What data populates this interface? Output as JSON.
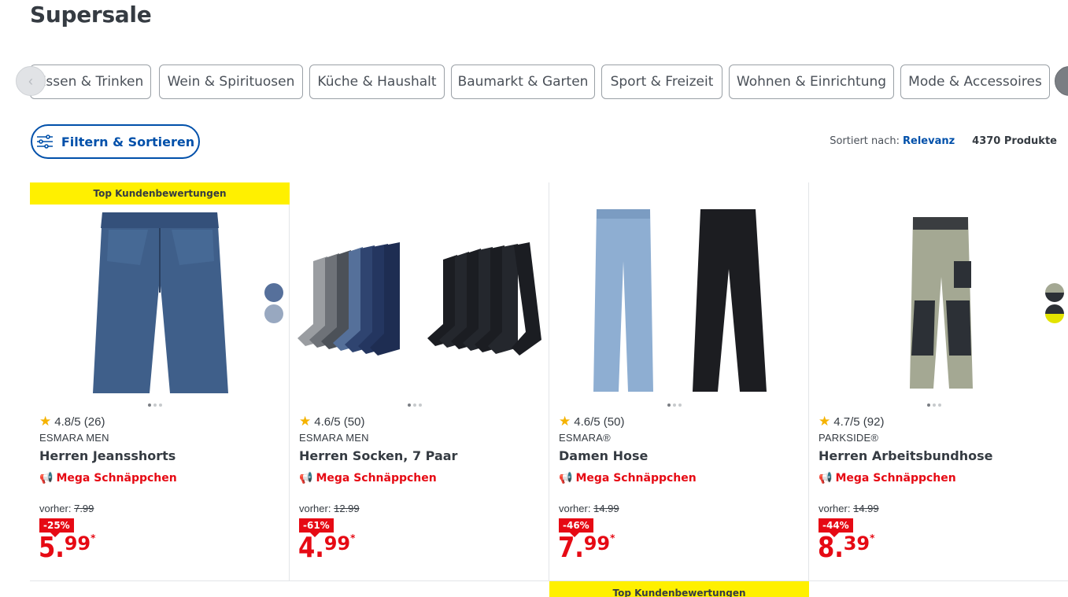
{
  "page": {
    "title": "Supersale"
  },
  "categories": [
    "Essen & Trinken",
    "Wein & Spirituosen",
    "Küche & Haushalt",
    "Baumarkt & Garten",
    "Sport & Freizeit",
    "Wohnen & Einrichtung",
    "Mode & Accessoires"
  ],
  "filter": {
    "label": "Filtern & Sortieren"
  },
  "sort": {
    "prefix": "Sortiert nach:",
    "value": "Relevanz",
    "count": "4370 Produkte"
  },
  "badges": {
    "top_reviews": "Top Kundenbewertungen"
  },
  "products": [
    {
      "rating": "4.8/5 (26)",
      "brand": "ESMARA MEN",
      "name": "Herren Jeansshorts",
      "promo": "Mega Schnäppchen",
      "prev_label": "vorher:",
      "prev_price": "7.99",
      "discount": "-25%",
      "price_int": "5.",
      "price_dec": "99",
      "price_ast": "*"
    },
    {
      "rating": "4.6/5 (50)",
      "brand": "ESMARA MEN",
      "name": "Herren Socken, 7 Paar",
      "promo": "Mega Schnäppchen",
      "prev_label": "vorher:",
      "prev_price": "12.99",
      "discount": "-61%",
      "price_int": "4.",
      "price_dec": "99",
      "price_ast": "*"
    },
    {
      "rating": "4.6/5 (50)",
      "brand": "ESMARA®",
      "name": "Damen Hose",
      "promo": "Mega Schnäppchen",
      "prev_label": "vorher:",
      "prev_price": "14.99",
      "discount": "-46%",
      "price_int": "7.",
      "price_dec": "99",
      "price_ast": "*"
    },
    {
      "rating": "4.7/5 (92)",
      "brand": "PARKSIDE®",
      "name": "Herren Arbeitsbundhose",
      "promo": "Mega Schnäppchen",
      "prev_label": "vorher:",
      "prev_price": "14.99",
      "discount": "-44%",
      "price_int": "8.",
      "price_dec": "39",
      "price_ast": "*"
    }
  ],
  "colors": {
    "brand_blue": "#0050aa",
    "sale_red": "#e60a14",
    "badge_yellow": "#fff000"
  }
}
